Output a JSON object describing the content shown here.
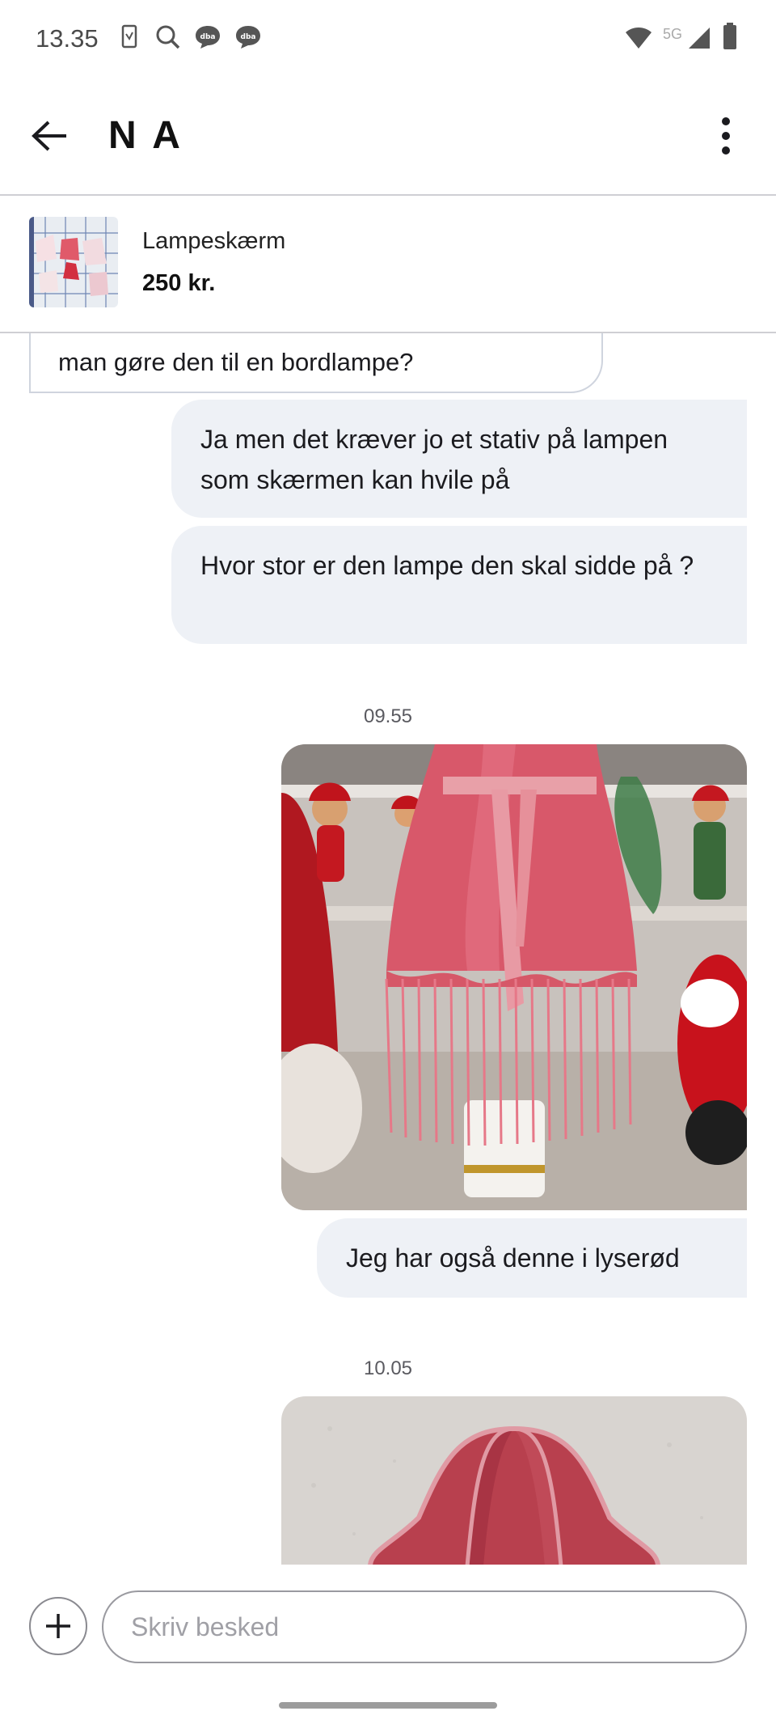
{
  "status_bar": {
    "time": "13.35",
    "network": "5G",
    "icons": [
      "sim-card-icon",
      "search-icon",
      "dba-chat-icon",
      "dba-chat-icon",
      "wifi-icon",
      "signal-icon",
      "battery-icon"
    ],
    "dba_label": "dba"
  },
  "header": {
    "title": "N A",
    "back_icon": "arrow-left-icon",
    "more_icon": "more-vert-icon"
  },
  "listing": {
    "title": "Lampeskærm",
    "price": "250 kr."
  },
  "messages": [
    {
      "direction": "incoming",
      "text": "man gøre den til en bordlampe?"
    },
    {
      "direction": "outgoing",
      "text": "Ja men det kræver jo et stativ på lampen som skærmen kan hvile på"
    },
    {
      "direction": "outgoing",
      "text": "Hvor stor er den lampe den skal sidde på ?"
    },
    {
      "type": "timestamp",
      "text": "09.55"
    },
    {
      "direction": "outgoing",
      "type": "image",
      "alt": "pink-lampshade-photo"
    },
    {
      "direction": "outgoing",
      "text": "Jeg har også denne i lyserød"
    },
    {
      "type": "timestamp",
      "text": "10.05"
    },
    {
      "direction": "outgoing",
      "type": "image",
      "alt": "rose-lampshade-photo"
    }
  ],
  "composer": {
    "placeholder": "Skriv besked",
    "value": ""
  },
  "colors": {
    "outgoing_bubble": "#eef1f6",
    "incoming_border": "#cfd4de",
    "divider": "#cfcfd4"
  }
}
